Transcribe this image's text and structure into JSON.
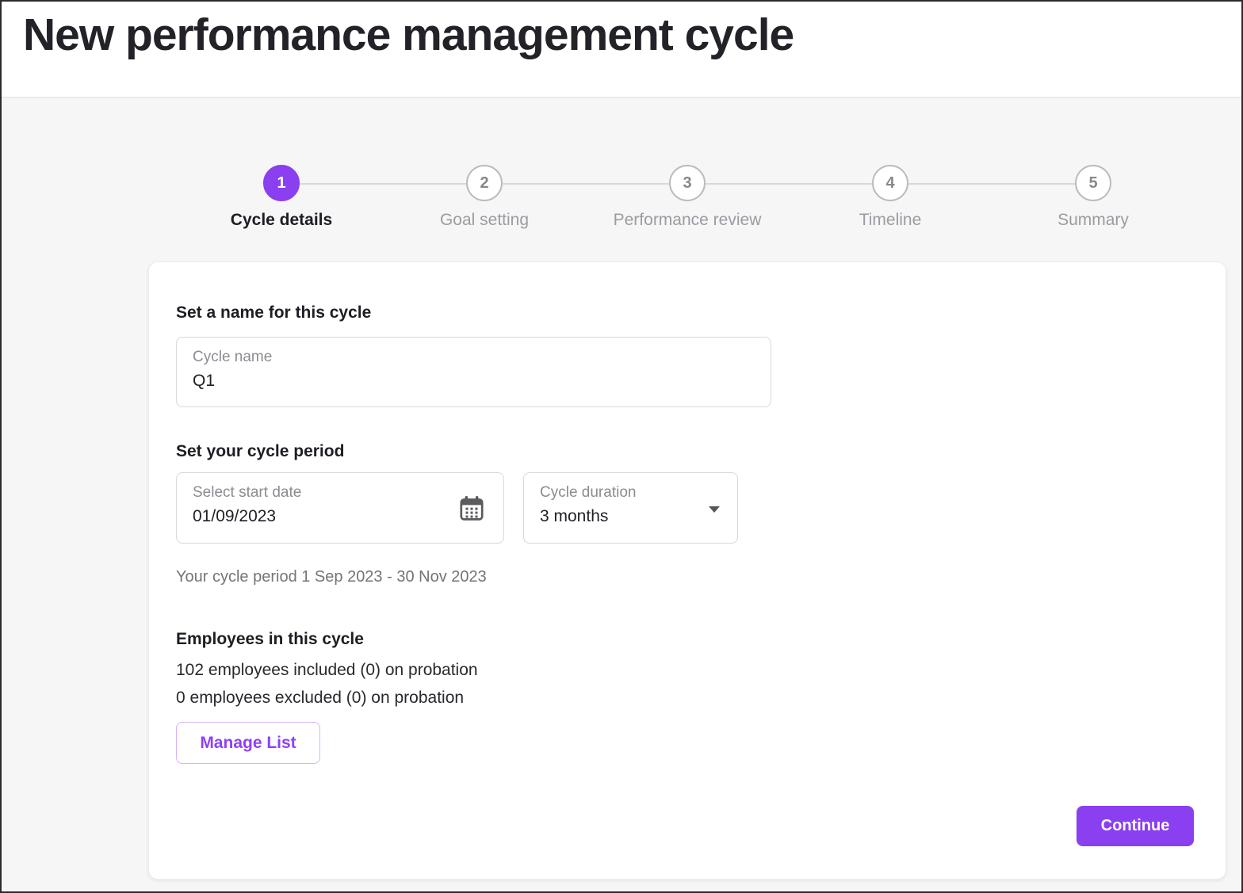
{
  "header": {
    "title": "New performance management cycle"
  },
  "stepper": {
    "steps": [
      {
        "number": "1",
        "label": "Cycle details",
        "state": "active"
      },
      {
        "number": "2",
        "label": "Goal setting",
        "state": "upcoming"
      },
      {
        "number": "3",
        "label": "Performance review",
        "state": "upcoming"
      },
      {
        "number": "4",
        "label": "Timeline",
        "state": "upcoming"
      },
      {
        "number": "5",
        "label": "Summary",
        "state": "upcoming"
      }
    ]
  },
  "form": {
    "name_section": {
      "heading": "Set a name for this cycle",
      "cycle_name_label": "Cycle name",
      "cycle_name_value": "Q1"
    },
    "period_section": {
      "heading": "Set your cycle period",
      "start_date_label": "Select start date",
      "start_date_value": "01/09/2023",
      "duration_label": "Cycle duration",
      "duration_value": "3 months",
      "period_summary": "Your cycle period 1 Sep 2023 - 30 Nov 2023"
    },
    "employees_section": {
      "heading": "Employees in this cycle",
      "included_line": "102 employees included (0) on probation",
      "excluded_line": "0 employees excluded (0) on probation",
      "manage_list_label": "Manage List"
    },
    "continue_label": "Continue"
  },
  "icons": {
    "calendar": "calendar-icon",
    "chevron_down": "chevron-down-icon"
  },
  "colors": {
    "accent": "#8a3ff0",
    "accent_light_border": "#d4b3fb",
    "page_background": "#f6f6f7",
    "inactive_gray": "#9b9ba1"
  }
}
